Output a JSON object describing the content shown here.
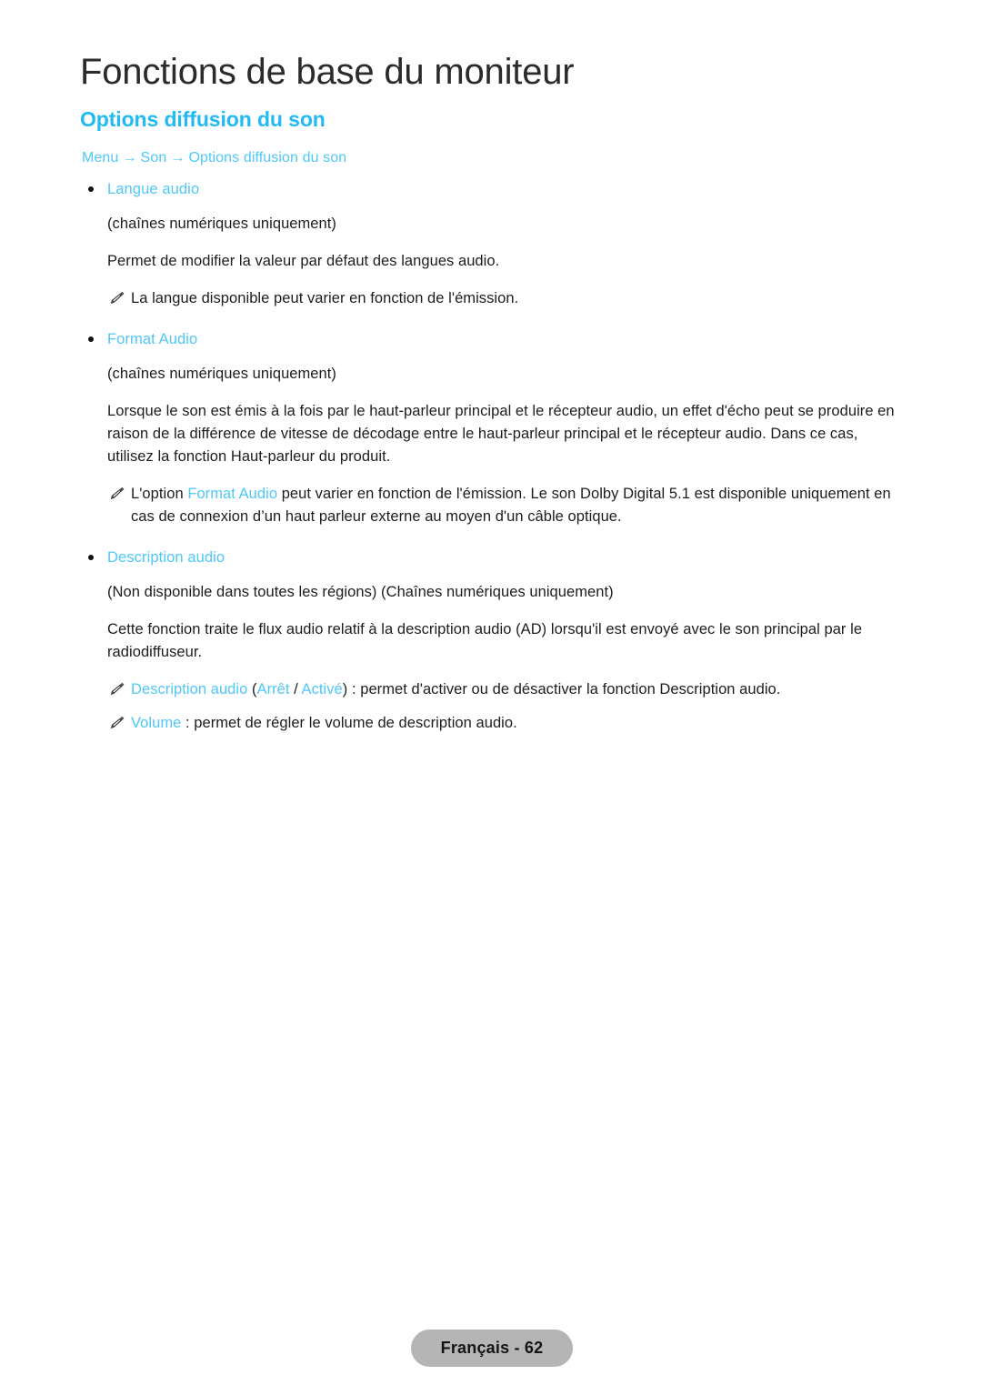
{
  "header": {
    "chapter_title": "Fonctions de base du moniteur",
    "section_title": "Options diffusion du son",
    "breadcrumb": {
      "items": [
        "Menu",
        "Son",
        "Options diffusion du son"
      ],
      "separator": "→"
    }
  },
  "sections": [
    {
      "heading": "Langue audio",
      "blocks": [
        {
          "kind": "para",
          "text": "(chaînes numériques uniquement)"
        },
        {
          "kind": "para",
          "text": "Permet de modifier la valeur par défaut des langues audio."
        },
        {
          "kind": "note",
          "icon": "pencil-icon",
          "text": "La langue disponible peut varier en fonction de l'émission."
        }
      ]
    },
    {
      "heading": "Format Audio",
      "blocks": [
        {
          "kind": "para",
          "text": "(chaînes numériques uniquement)"
        },
        {
          "kind": "para",
          "text": "Lorsque le son est émis à la fois par le haut-parleur principal et le récepteur audio, un effet d'écho peut se produire en raison de la différence de vitesse de décodage entre le haut-parleur principal et le récepteur audio. Dans ce cas, utilisez la fonction Haut-parleur du produit."
        },
        {
          "kind": "note-rich",
          "icon": "pencil-icon",
          "parts": [
            {
              "text": "L'option ",
              "accent": false
            },
            {
              "text": "Format Audio",
              "accent": true
            },
            {
              "text": " peut varier en fonction de l'émission. Le son Dolby Digital 5.1 est disponible uniquement en cas de connexion d’un haut parleur externe au moyen d'un câble optique.",
              "accent": false
            }
          ]
        }
      ]
    },
    {
      "heading": "Description audio",
      "blocks": [
        {
          "kind": "para",
          "text": "(Non disponible dans toutes les régions) (Chaînes numériques uniquement)"
        },
        {
          "kind": "para",
          "text": "Cette fonction traite le flux audio relatif à la description audio (AD) lorsqu'il est envoyé avec le son principal par le radiodiffuseur."
        },
        {
          "kind": "note-rich",
          "icon": "pencil-icon",
          "parts": [
            {
              "text": "Description audio",
              "accent": true
            },
            {
              "text": " (",
              "accent": false
            },
            {
              "text": "Arrêt",
              "accent": true
            },
            {
              "text": " / ",
              "accent": false
            },
            {
              "text": "Activé",
              "accent": true
            },
            {
              "text": ") : permet d'activer ou de désactiver la fonction Description audio.",
              "accent": false
            }
          ]
        },
        {
          "kind": "note-rich",
          "icon": "pencil-icon",
          "parts": [
            {
              "text": "Volume",
              "accent": true
            },
            {
              "text": " : permet de régler le volume de description audio.",
              "accent": false
            }
          ]
        }
      ]
    }
  ],
  "footer": {
    "label": "Français - 62"
  },
  "colors": {
    "accent": "#4fc8f7",
    "heading_accent": "#21baf5",
    "body_text": "#1d1d1d",
    "title_text": "#2b2b2b",
    "footer_pill": "#b5b5b5"
  }
}
